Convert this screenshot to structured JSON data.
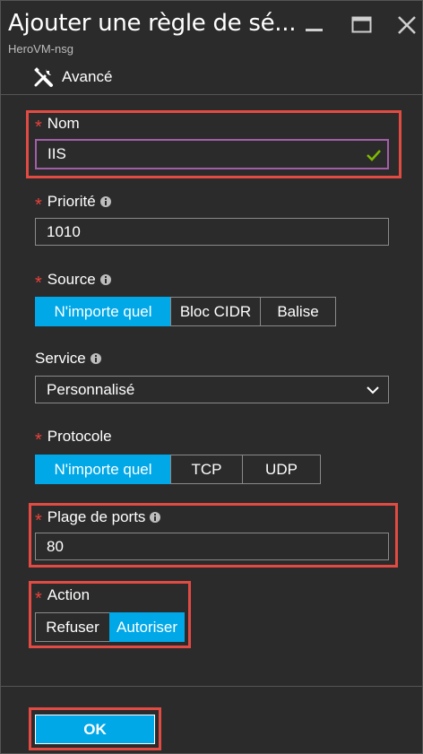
{
  "window": {
    "title": "Ajouter une règle de sé...",
    "subtitle": "HeroVM-nsg"
  },
  "toolbar": {
    "advanced_label": "Avancé"
  },
  "form": {
    "required_mark": "*",
    "name": {
      "label": "Nom",
      "value": "IIS"
    },
    "priority": {
      "label": "Priorité",
      "value": "1010"
    },
    "source": {
      "label": "Source",
      "options": [
        "N'importe quel",
        "Bloc CIDR",
        "Balise"
      ],
      "selected": "N'importe quel"
    },
    "service": {
      "label": "Service",
      "value": "Personnalisé"
    },
    "protocol": {
      "label": "Protocole",
      "options": [
        "N'importe quel",
        "TCP",
        "UDP"
      ],
      "selected": "N'importe quel"
    },
    "port_range": {
      "label": "Plage de ports",
      "value": "80"
    },
    "action": {
      "label": "Action",
      "options": [
        "Refuser",
        "Autoriser"
      ],
      "selected": "Autoriser"
    }
  },
  "footer": {
    "ok_label": "OK"
  },
  "colors": {
    "background": "#2b2b2b",
    "accent": "#00a8e8",
    "highlight": "#e14b43",
    "required": "#e8423c",
    "active_border": "#a35ea8",
    "valid_check": "#7fba00"
  },
  "icons": {
    "minimize": "minimize-icon",
    "maximize": "maximize-icon",
    "close": "close-icon",
    "advanced": "tools-icon",
    "info": "info-icon",
    "valid": "checkmark-icon",
    "dropdown": "chevron-down-icon"
  }
}
